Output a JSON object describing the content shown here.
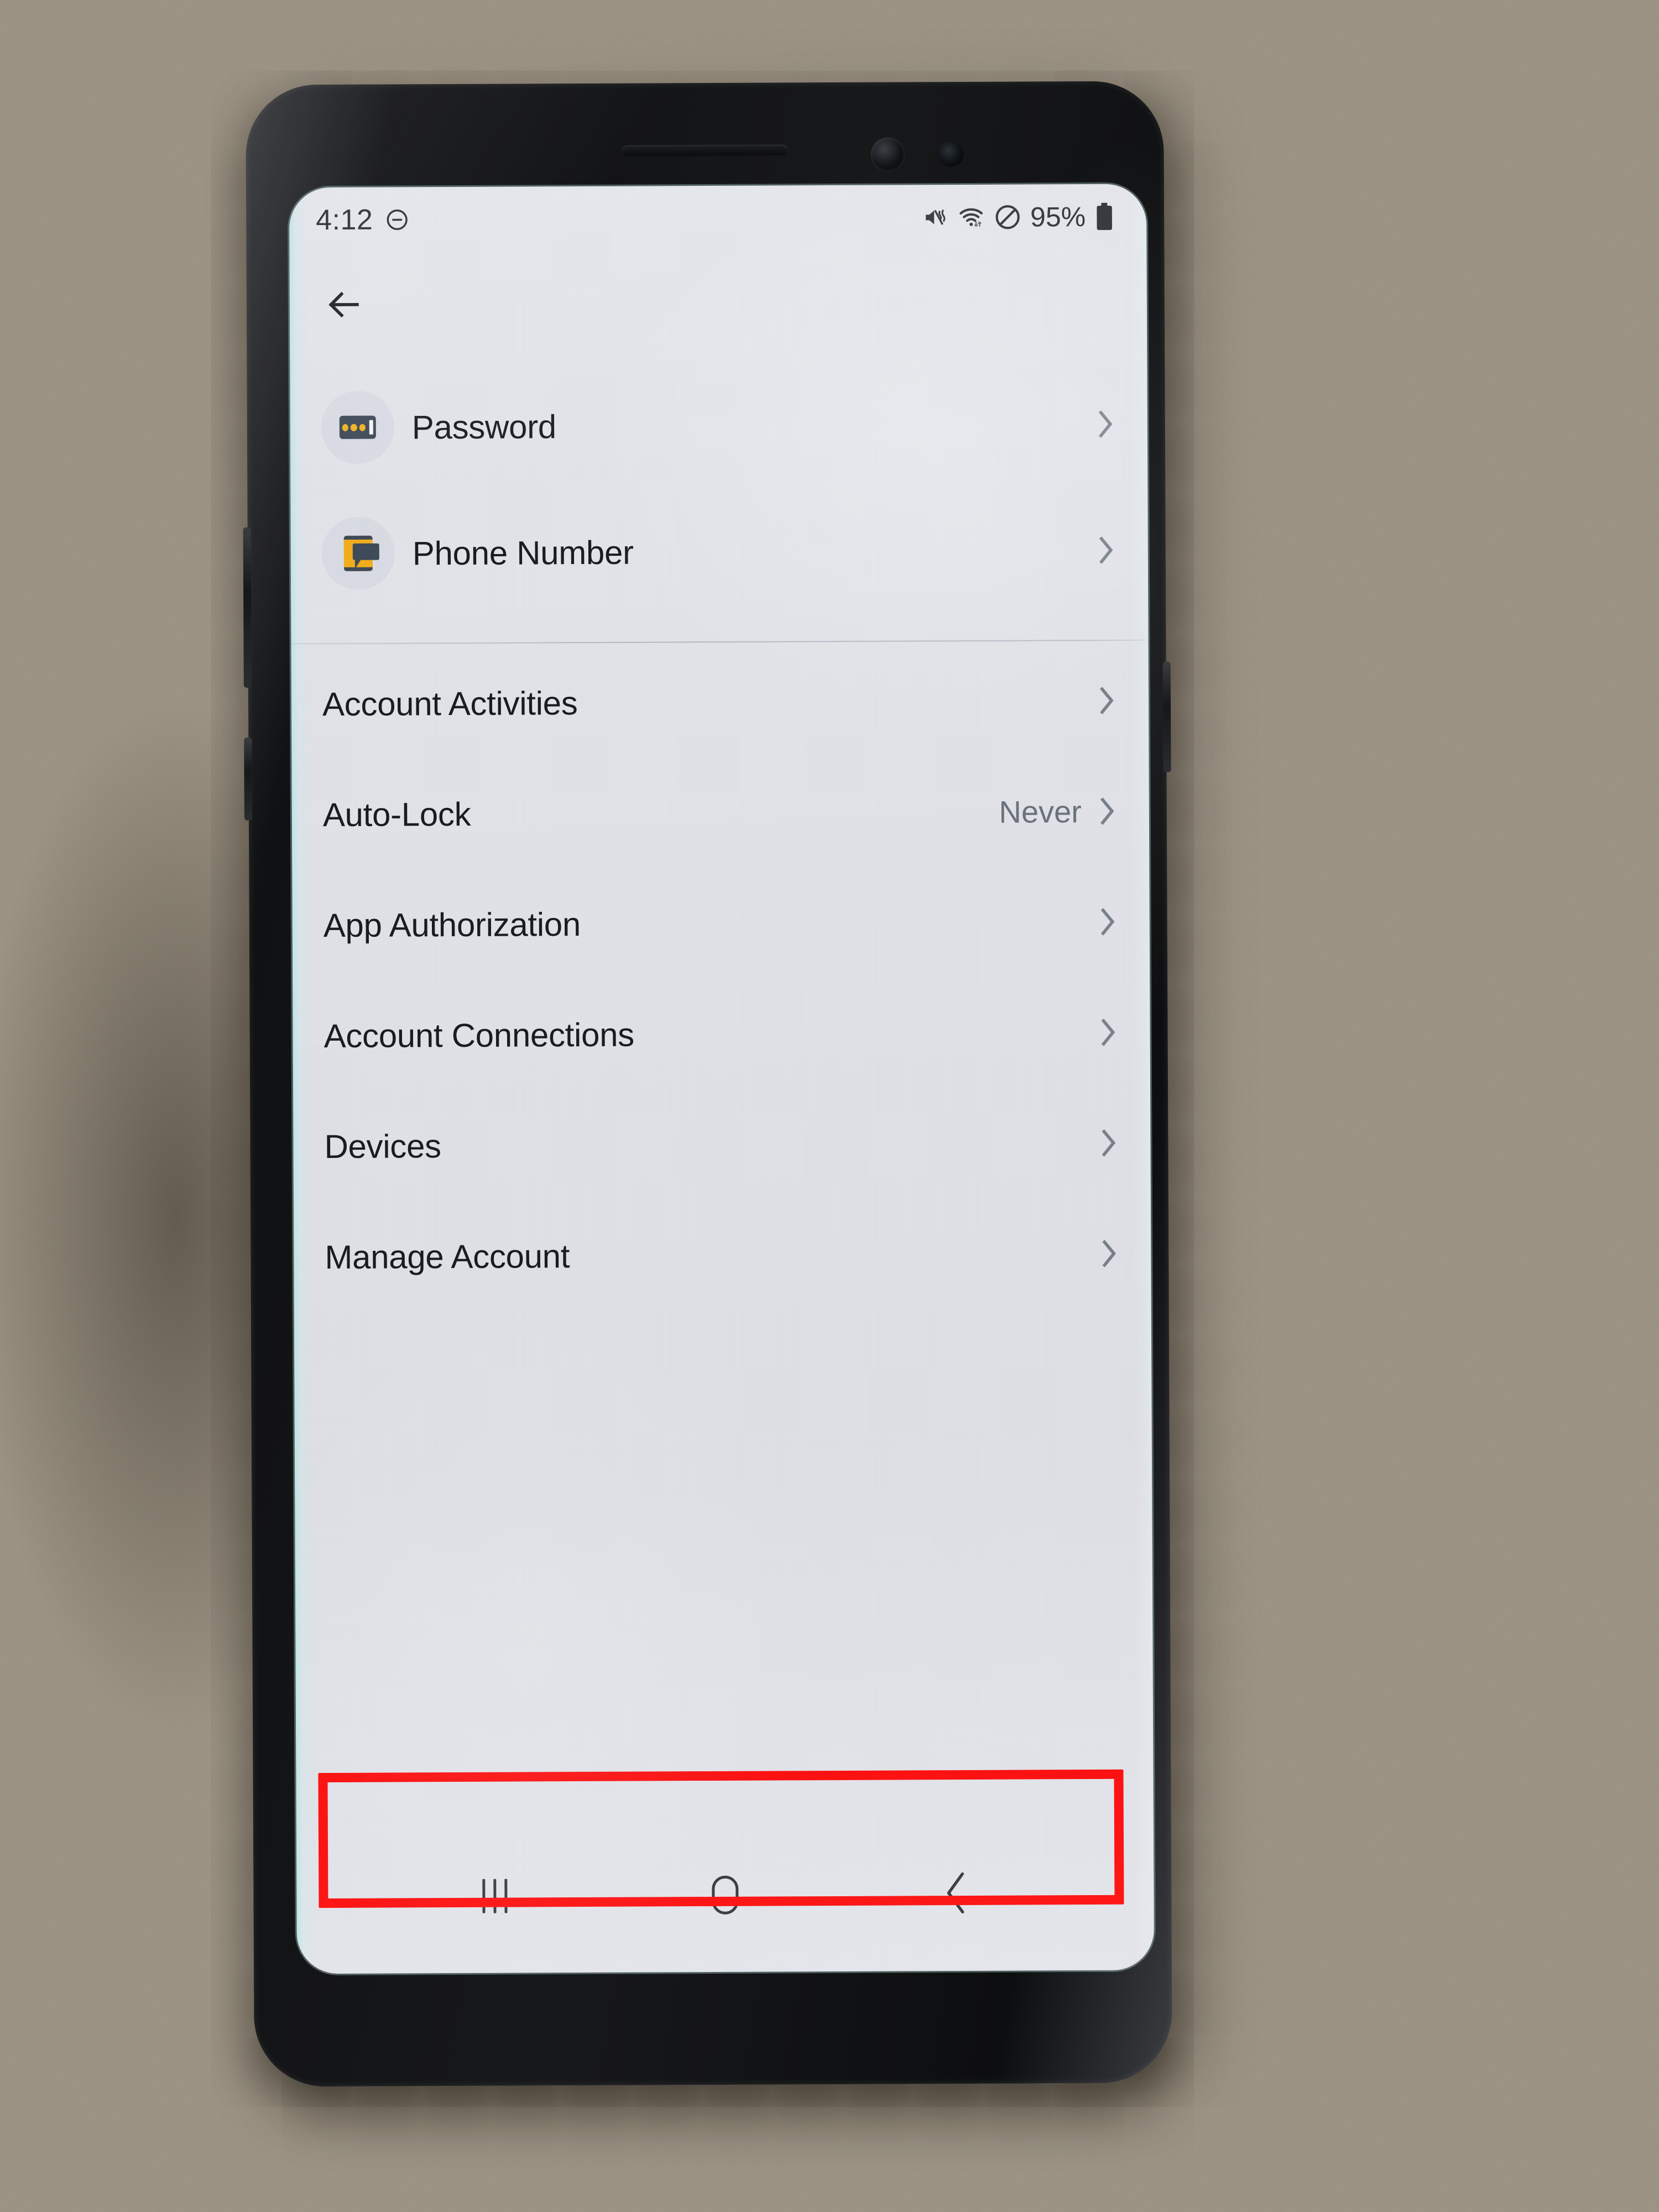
{
  "status_bar": {
    "time": "4:12",
    "dnd_left_icon": "do-not-disturb-icon",
    "icons": [
      "sound-mute-vibrate-icon",
      "wifi-icon",
      "do-not-disturb-icon",
      "battery-icon"
    ],
    "battery_percent": "95%"
  },
  "app_header": {
    "back_icon": "back-arrow-icon",
    "title": ""
  },
  "sections": [
    {
      "id": "credentials",
      "items": [
        {
          "label": "Password",
          "icon": "password-dots-icon",
          "value": "",
          "chevron": true
        },
        {
          "label": "Phone Number",
          "icon": "phone-message-icon",
          "value": "",
          "chevron": true
        }
      ]
    },
    {
      "id": "account",
      "items": [
        {
          "label": "Account Activities",
          "icon": "",
          "value": "",
          "chevron": true
        },
        {
          "label": "Auto-Lock",
          "icon": "",
          "value": "Never",
          "chevron": true
        },
        {
          "label": "App Authorization",
          "icon": "",
          "value": "",
          "chevron": true
        },
        {
          "label": "Account Connections",
          "icon": "",
          "value": "",
          "chevron": true
        },
        {
          "label": "Devices",
          "icon": "",
          "value": "",
          "chevron": true
        },
        {
          "label": "Manage Account",
          "icon": "",
          "value": "",
          "chevron": true
        }
      ]
    }
  ],
  "annotation": {
    "target_label": "Manage Account",
    "color": "#ff0000",
    "shape": "rectangle"
  },
  "nav_bar": {
    "recents_label": "recents-icon",
    "home_label": "home-icon",
    "back_label": "back-icon"
  },
  "colors": {
    "screen_bg": "#e2e4ea",
    "text_primary": "#181c21",
    "text_secondary": "#6c737d",
    "accent_yellow": "#f2ae1c",
    "icon_dark": "#3f4a58",
    "annotation_red": "#ff0000"
  }
}
